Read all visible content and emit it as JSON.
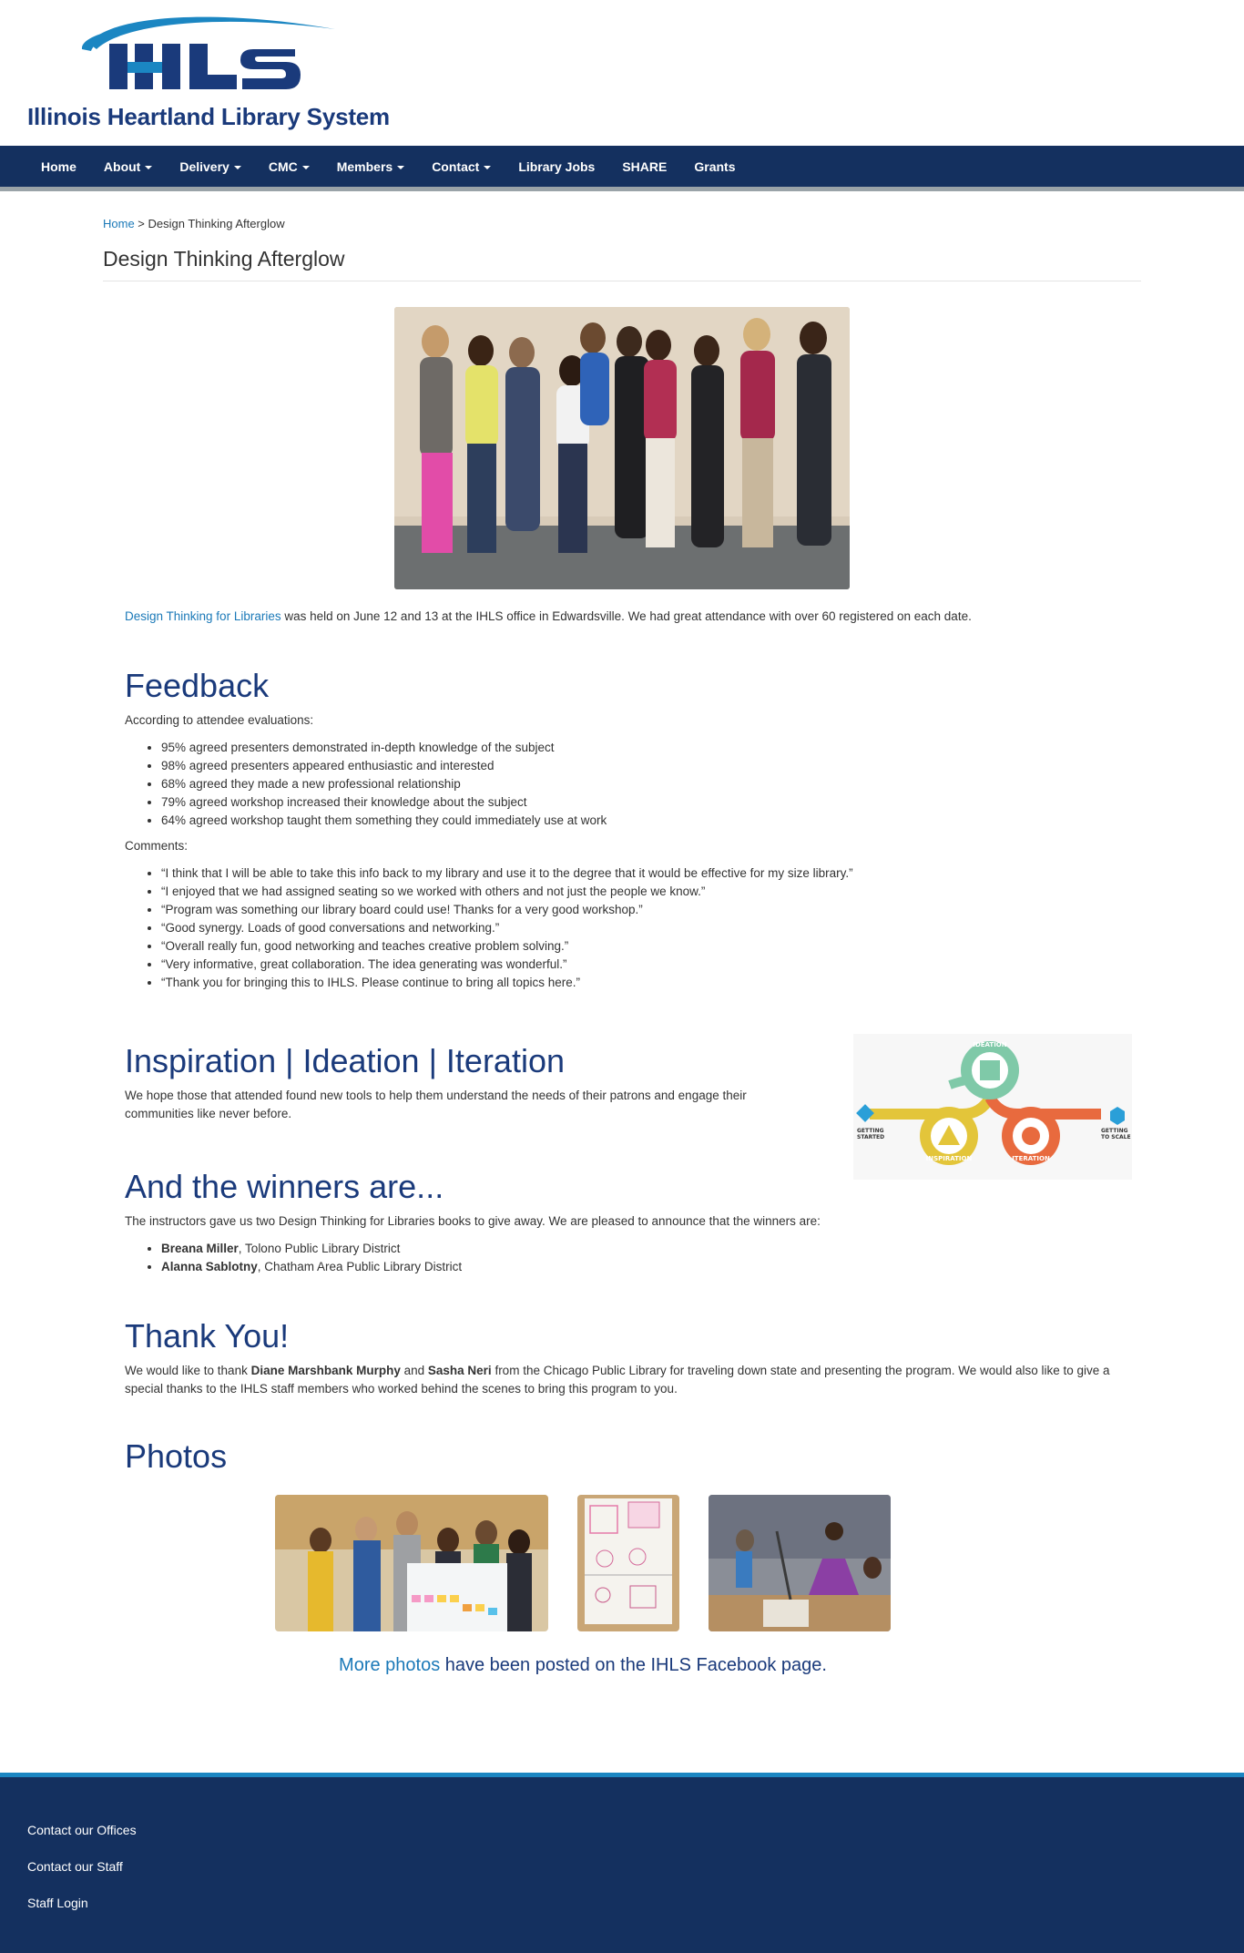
{
  "header": {
    "logo_mark": "IHLS",
    "logo_text": "Illinois Heartland Library System"
  },
  "nav": [
    {
      "label": "Home",
      "dropdown": false
    },
    {
      "label": "About",
      "dropdown": true
    },
    {
      "label": "Delivery",
      "dropdown": true
    },
    {
      "label": "CMC",
      "dropdown": true
    },
    {
      "label": "Members",
      "dropdown": true
    },
    {
      "label": "Contact",
      "dropdown": true
    },
    {
      "label": "Library Jobs",
      "dropdown": false
    },
    {
      "label": "SHARE",
      "dropdown": false
    },
    {
      "label": "Grants",
      "dropdown": false
    }
  ],
  "breadcrumb": {
    "home": "Home",
    "separator": " > ",
    "current": "Design Thinking Afterglow"
  },
  "page_title": "Design Thinking Afterglow",
  "intro": {
    "link": "Design Thinking for Libraries",
    "text": " was held on June 12 and 13 at the IHLS office in Edwardsville. We had great attendance with over 60 registered on each date."
  },
  "feedback": {
    "heading": "Feedback",
    "lead": "According to attendee evaluations:",
    "stats": [
      "95% agreed presenters demonstrated in-depth knowledge of the subject",
      "98% agreed presenters appeared enthusiastic and interested",
      "68% agreed they made a new professional relationship",
      "79% agreed workshop increased their knowledge about the subject",
      "64% agreed workshop taught them something they could immediately use at work"
    ],
    "comments_label": "Comments:",
    "comments": [
      "“I think that I will be able to take this info back to my library and use it to the degree that it would be effective for my size library.”",
      "“I enjoyed that we had assigned seating so we worked with others and not just the people we know.”",
      "“Program was something our library board could use! Thanks for a very good workshop.”",
      "“Good synergy. Loads of good conversations and networking.”",
      "“Overall really fun, good networking and teaches creative problem solving.”",
      "“Very informative, great collaboration. The idea generating was wonderful.”",
      "“Thank you for bringing this to IHLS. Please continue to bring all topics here.”"
    ]
  },
  "inspiration": {
    "heading": "Inspiration | Ideation | Iteration",
    "text": "We hope those that attended found new tools to help them understand the needs of their patrons and engage their communities like never before.",
    "graphic_labels": {
      "ideation": "IDEATION",
      "inspiration": "INSPIRATION",
      "iteration": "ITERATION",
      "start_1": "GETTING",
      "start_2": "STARTED",
      "scale_1": "GETTING",
      "scale_2": "TO SCALE"
    }
  },
  "winners": {
    "heading": "And the winners are...",
    "text": "The instructors gave us two Design Thinking for Libraries books to give away. We are pleased to announce that the winners are:",
    "list": [
      {
        "name": "Breana Miller",
        "org": ", Tolono Public Library District"
      },
      {
        "name": "Alanna Sablotny",
        "org": ", Chatham Area Public Library District"
      }
    ]
  },
  "thanks": {
    "heading": "Thank You!",
    "pre": "We would like to thank ",
    "name1": "Diane Marshbank Murphy",
    "mid": " and ",
    "name2": "Sasha Neri",
    "post": " from the Chicago Public Library for traveling down state and presenting the program. We would also like to give a special thanks to the IHLS staff members who worked behind the scenes to bring this program to you."
  },
  "photos": {
    "heading": "Photos",
    "more_link": "More photos",
    "more_text": " have been posted on the IHLS Facebook page."
  },
  "footer": {
    "links": [
      "Contact our Offices",
      "Contact our Staff",
      "Staff Login"
    ]
  },
  "colors": {
    "navy": "#14305f",
    "heading_blue": "#1a3a7b",
    "link_blue": "#1b79b8",
    "footer_accent": "#1b86c2"
  }
}
